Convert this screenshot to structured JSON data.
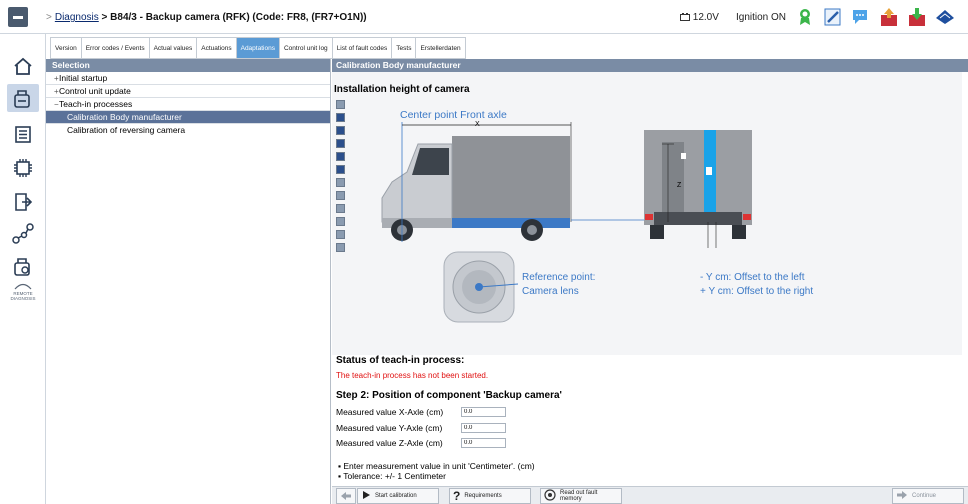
{
  "header": {
    "breadcrumb_sep": ">",
    "breadcrumb_link": "Diagnosis",
    "breadcrumb_rest": "> B84/3 - Backup camera (RFK) (Code: FR8, (FR7+O1N))",
    "voltage": "12.0V",
    "ignition": "Ignition ON"
  },
  "tabs": [
    {
      "label": "Version"
    },
    {
      "label": "Error codes / Events"
    },
    {
      "label": "Actual values"
    },
    {
      "label": "Actuations"
    },
    {
      "label": "Adaptations"
    },
    {
      "label": "Control unit log"
    },
    {
      "label": "List of fault codes"
    },
    {
      "label": "Tests"
    },
    {
      "label": "Erstellerdaten"
    }
  ],
  "rail": {
    "remote_label": "REMOTE DIAGNOSIS"
  },
  "selection": {
    "title": "Selection",
    "items": [
      {
        "expander": "+",
        "label": "Initial startup"
      },
      {
        "expander": "+",
        "label": "Control unit update"
      },
      {
        "expander": "−",
        "label": "Teach-in processes"
      },
      {
        "expander": "",
        "label": "Calibration Body manufacturer"
      },
      {
        "expander": "",
        "label": "Calibration of reversing camera"
      }
    ]
  },
  "content": {
    "title": "Calibration Body manufacturer",
    "figure_title": "Installation height of camera",
    "center_point_label": "Center point Front axle",
    "x_label": "X",
    "z_label": "Z",
    "ref_label_1": "Reference point:",
    "ref_label_2": "Camera lens",
    "offset_left": "- Y cm:  Offset to the left",
    "offset_right": "+ Y cm:  Offset to the right",
    "status_title": "Status of teach-in process:",
    "status_text": "The teach-in process has not been started.",
    "step_title": "Step 2: Position of component 'Backup camera'",
    "fields": [
      {
        "label": "Measured value X-Axle (cm)",
        "value": "0.0"
      },
      {
        "label": "Measured value Y-Axle (cm)",
        "value": "0.0"
      },
      {
        "label": "Measured value Z-Axle (cm)",
        "value": "0.0"
      }
    ],
    "bullets": [
      "Enter measurement value in unit 'Centimeter'. (cm)",
      "Tolerance: +/- 1 Centimeter"
    ]
  },
  "bottombar": {
    "start_calibration": "Start calibration",
    "requirements": "Requirements",
    "read_out_fault_memory": "Read out fault memory",
    "continue": "Continue"
  },
  "colors": {
    "accent_blue": "#3c79c6",
    "panel_header": "#7a8ca5",
    "selected_row": "#5b7299",
    "status_red": "#e01010"
  }
}
